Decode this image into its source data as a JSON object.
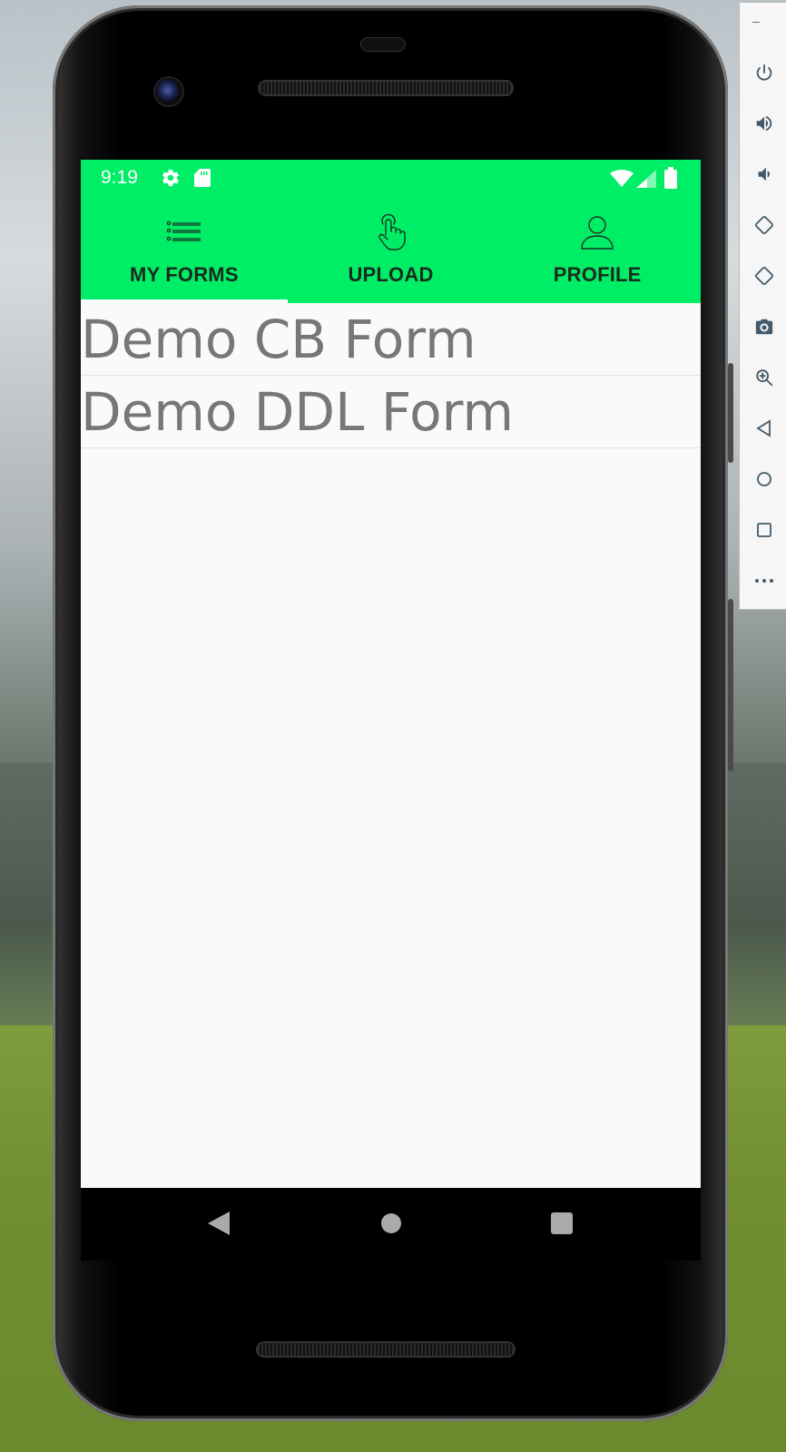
{
  "status_bar": {
    "time": "9:19",
    "icons": [
      "settings-icon",
      "sd-card-icon",
      "wifi-icon",
      "signal-icon",
      "battery-icon"
    ]
  },
  "tabs": [
    {
      "label": "MY FORMS",
      "icon": "list-icon",
      "selected": true
    },
    {
      "label": "UPLOAD",
      "icon": "touch-icon",
      "selected": false
    },
    {
      "label": "PROFILE",
      "icon": "person-icon",
      "selected": false
    }
  ],
  "forms": [
    {
      "label": "Demo CB Form"
    },
    {
      "label": "Demo DDL Form"
    }
  ],
  "navigation": [
    "back-icon",
    "home-icon",
    "recents-icon"
  ],
  "emulator_controls": {
    "window_buttons": "–",
    "buttons": [
      "power-icon",
      "volume-up-icon",
      "volume-down-icon",
      "rotate-left-icon",
      "rotate-right-icon",
      "screenshot-icon",
      "zoom-icon",
      "back-icon",
      "home-icon",
      "overview-icon",
      "more-icon"
    ]
  },
  "colors": {
    "accent": "#00EE66",
    "tab_text": "#1A2A1F",
    "list_text": "#777777",
    "screen_bg": "#FAFAFA"
  }
}
